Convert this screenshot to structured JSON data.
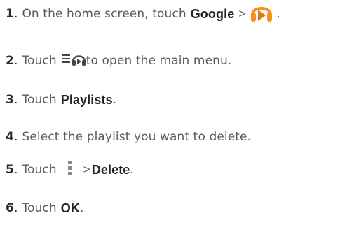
{
  "steps": [
    {
      "number": "1",
      "sep": ".",
      "text_before": "On the home screen, touch",
      "bold": "Google",
      "gt": ">",
      "icon": "play-music-headphones-icon",
      "text_after": "."
    },
    {
      "number": "2",
      "sep": ".",
      "text_before": "Touch",
      "icon": "menu-headphones-icon",
      "text_after": "to open the main menu."
    },
    {
      "number": "3",
      "sep": ".",
      "text_before": "Touch",
      "bold": "Playlists",
      "text_after": "."
    },
    {
      "number": "4",
      "sep": ".",
      "text_before": "Select the playlist you want to delete."
    },
    {
      "number": "5",
      "sep": ".",
      "text_before": "Touch",
      "icon": "overflow-menu-icon",
      "gt": ">",
      "bold": "Delete",
      "text_after": "."
    },
    {
      "number": "6",
      "sep": ".",
      "text_before": "Touch",
      "bold": "OK",
      "text_after": "."
    }
  ],
  "colors": {
    "text": "#5a5a5a",
    "emphasis": "#222222",
    "icon_orange": "#f5921e",
    "icon_gray": "#8a8a8a"
  }
}
